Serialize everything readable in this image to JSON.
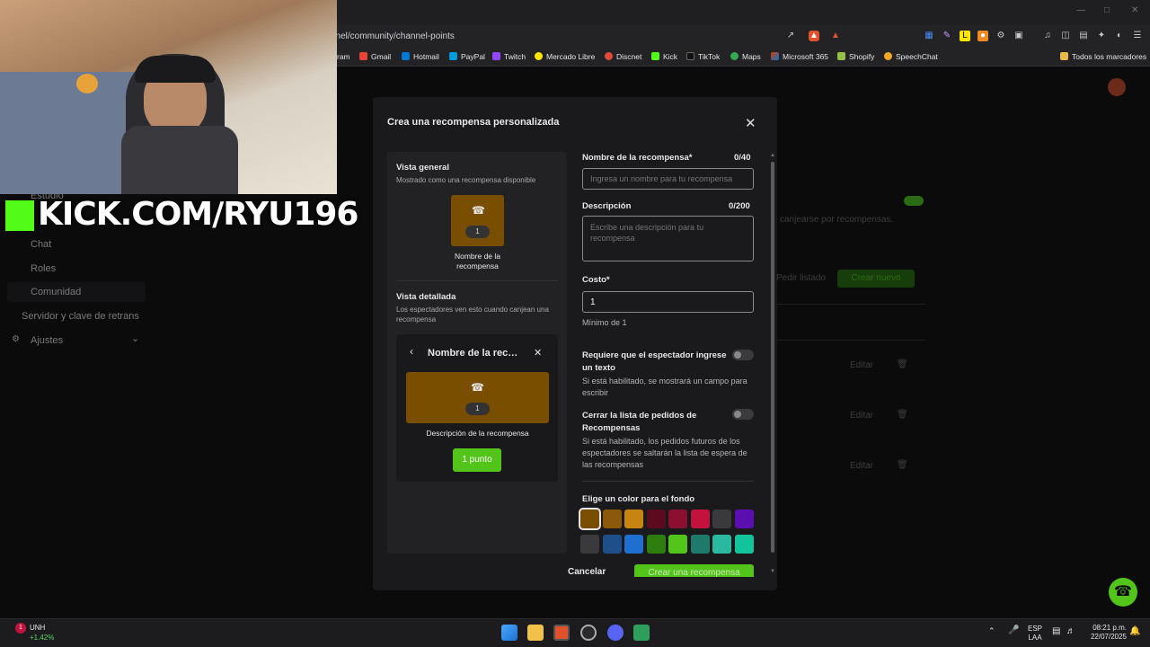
{
  "browser": {
    "url": "nnel/community/channel-points",
    "bookmarks": [
      {
        "label": "ram",
        "color": "#c13584"
      },
      {
        "label": "Gmail",
        "color": "#ea4335"
      },
      {
        "label": "Hotmail",
        "color": "#0078d4"
      },
      {
        "label": "PayPal",
        "color": "#003087"
      },
      {
        "label": "Twitch",
        "color": "#9146ff"
      },
      {
        "label": "Mercado Libre",
        "color": "#ffe600"
      },
      {
        "label": "Discnet",
        "color": "#e24a3b"
      },
      {
        "label": "Kick",
        "color": "#53fc18"
      },
      {
        "label": "TikTok",
        "color": "#111111"
      },
      {
        "label": "Maps",
        "color": "#34a853"
      },
      {
        "label": "Microsoft 365",
        "color": "#d83b01"
      },
      {
        "label": "Shopify",
        "color": "#95bf47"
      },
      {
        "label": "SpeechChat",
        "color": "#f5a623"
      }
    ],
    "all_bookmarks": "Todos los marcadores"
  },
  "overlay": {
    "kick_text": "KICK.COM/RYU196"
  },
  "sidebar": {
    "items": [
      "Estudio",
      "Chat",
      "Roles",
      "Comunidad",
      "Servidor y clave de retrans",
      "Ajustes"
    ]
  },
  "background_page": {
    "redeem_text": "canjearse por recompensas.",
    "request_list": "Pedir listado",
    "create_new": "Crear nuevo",
    "edit_label": "Editar"
  },
  "modal": {
    "title": "Crea una recompensa personalizada",
    "overview": {
      "title": "Vista general",
      "subtitle": "Mostrado como una recompensa disponible",
      "count": "1",
      "name": "Nombre de la recompensa"
    },
    "detail": {
      "title": "Vista detallada",
      "subtitle": "Los espectadores ven esto cuando canjean una recompensa",
      "card_title": "Nombre de la recompensa",
      "count": "1",
      "description": "Descripción de la recompensa",
      "points_button": "1 punto"
    },
    "form": {
      "name_label": "Nombre de la recompensa*",
      "name_count": "0/40",
      "name_placeholder": "Ingresa un nombre para tu recompensa",
      "desc_label": "Descripción",
      "desc_count": "0/200",
      "desc_placeholder": "Escribe una descripción para tu recompensa",
      "cost_label": "Costo*",
      "cost_value": "1",
      "cost_hint": "Mínimo de 1",
      "require_text_label": "Requiere que el espectador ingrese un texto",
      "require_text_hint": "Si está habilitado, se mostrará un campo para escribir",
      "close_list_label": "Cerrar la lista de pedidos de Recompensas",
      "close_list_hint": "Si está habilitado, los pedidos futuros de los espectadores se saltarán la lista de espera de las recompensas",
      "color_label": "Elige un color para el fondo",
      "colors_row1": [
        "#7a4e00",
        "#8a5a0a",
        "#c88410",
        "#5c0a1e",
        "#8a0f30",
        "#c4123f",
        "#3a3a3d",
        "#5b0fb0"
      ],
      "colors_row2": [
        "#3a3a3d",
        "#1e4f8a",
        "#1f6fd0",
        "#2e7d0f",
        "#53c41a",
        "#1e7a6a",
        "#2ab8a0",
        "#12c49c"
      ]
    },
    "cancel": "Cancelar",
    "create": "Crear una recompensa"
  },
  "taskbar": {
    "stock_name": "UNH",
    "stock_change": "+1.42%",
    "lang": "ESP",
    "lang2": "LAA",
    "time": "08:21 p.m.",
    "date": "22/07/2025"
  }
}
